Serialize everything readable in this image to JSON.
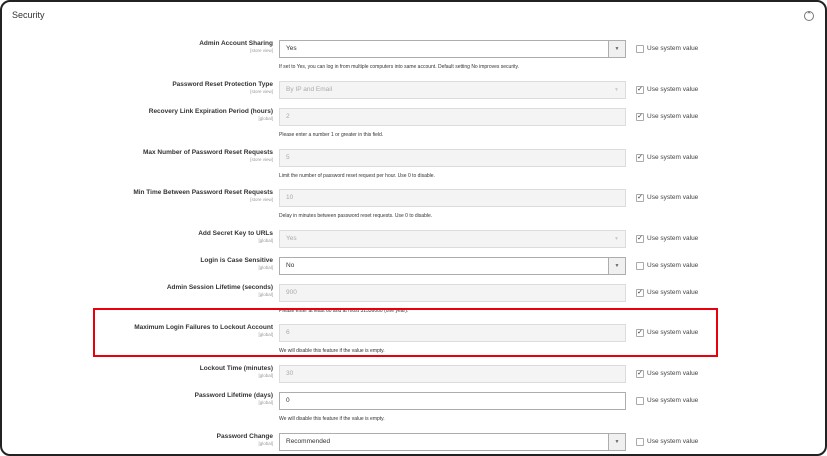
{
  "section": {
    "title": "Security",
    "collapse_icon": "collapse-circle-icon"
  },
  "use_system_label": "Use system value",
  "rows": [
    {
      "label": "Admin Account Sharing",
      "scope": "[store view]",
      "type": "select",
      "value": "Yes",
      "disabled": false,
      "use_system": false,
      "note": "If set to Yes, you can log in from multiple computers into same account. Default setting No improves security."
    },
    {
      "label": "Password Reset Protection Type",
      "scope": "[store view]",
      "type": "select",
      "value": "By IP and Email",
      "disabled": true,
      "use_system": true,
      "note": ""
    },
    {
      "label": "Recovery Link Expiration Period (hours)",
      "scope": "[global]",
      "type": "input",
      "value": "2",
      "disabled": true,
      "use_system": true,
      "note": "Please enter a number 1 or greater in this field."
    },
    {
      "label": "Max Number of Password Reset Requests",
      "scope": "[store view]",
      "type": "input",
      "value": "5",
      "disabled": true,
      "use_system": true,
      "note": "Limit the number of password reset request per hour. Use 0 to disable."
    },
    {
      "label": "Min Time Between Password Reset Requests",
      "scope": "[store view]",
      "type": "input",
      "value": "10",
      "disabled": true,
      "use_system": true,
      "note": "Delay in minutes between password reset requests. Use 0 to disable."
    },
    {
      "label": "Add Secret Key to URLs",
      "scope": "[global]",
      "type": "select",
      "value": "Yes",
      "disabled": true,
      "use_system": true,
      "note": ""
    },
    {
      "label": "Login is Case Sensitive",
      "scope": "[global]",
      "type": "select",
      "value": "No",
      "disabled": false,
      "use_system": false,
      "note": ""
    },
    {
      "label": "Admin Session Lifetime (seconds)",
      "scope": "[global]",
      "type": "input",
      "value": "900",
      "disabled": true,
      "use_system": true,
      "note": "Please enter at least 60 and at most 31536000 (one year)."
    },
    {
      "label": "Maximum Login Failures to Lockout Account",
      "scope": "[global]",
      "type": "input",
      "value": "6",
      "disabled": true,
      "use_system": true,
      "note": "We will disable this feature if the value is empty.",
      "highlighted": true
    },
    {
      "label": "Lockout Time (minutes)",
      "scope": "[global]",
      "type": "input",
      "value": "30",
      "disabled": true,
      "use_system": true,
      "note": ""
    },
    {
      "label": "Password Lifetime (days)",
      "scope": "[global]",
      "type": "input",
      "value": "0",
      "disabled": false,
      "use_system": false,
      "note": "We will disable this feature if the value is empty."
    },
    {
      "label": "Password Change",
      "scope": "[global]",
      "type": "select",
      "value": "Recommended",
      "disabled": false,
      "use_system": false,
      "note": ""
    }
  ],
  "highlight_color": "#e8000b"
}
